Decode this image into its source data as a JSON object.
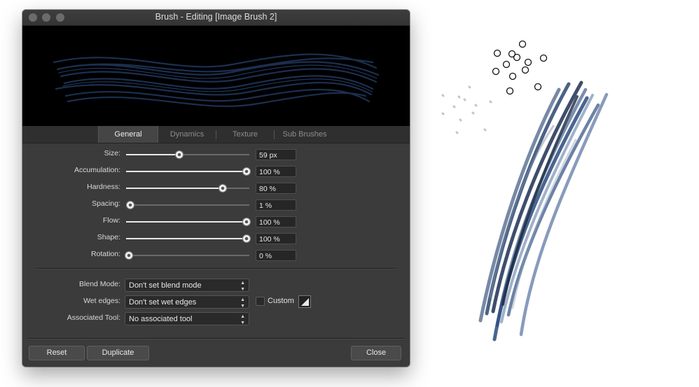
{
  "window": {
    "title": "Brush - Editing [Image Brush 2]"
  },
  "tabs": [
    {
      "label": "General",
      "active": true
    },
    {
      "label": "Dynamics",
      "active": false
    },
    {
      "label": "Texture",
      "active": false
    },
    {
      "label": "Sub Brushes",
      "active": false
    }
  ],
  "sliders": [
    {
      "label": "Size:",
      "fraction": 0.43,
      "value": "59 px"
    },
    {
      "label": "Accumulation:",
      "fraction": 1.0,
      "value": "100 %"
    },
    {
      "label": "Hardness:",
      "fraction": 0.8,
      "value": "80 %"
    },
    {
      "label": "Spacing:",
      "fraction": 0.01,
      "value": "1 %"
    },
    {
      "label": "Flow:",
      "fraction": 1.0,
      "value": "100 %"
    },
    {
      "label": "Shape:",
      "fraction": 1.0,
      "value": "100 %"
    },
    {
      "label": "Rotation:",
      "fraction": 0.0,
      "value": "0 %"
    }
  ],
  "blend_mode": {
    "label": "Blend Mode:",
    "value": "Don't set blend mode"
  },
  "wet_edges": {
    "label": "Wet edges:",
    "value": "Don't set wet edges",
    "custom_label": "Custom",
    "custom_checked": false
  },
  "associated_tool": {
    "label": "Associated Tool:",
    "value": "No associated tool"
  },
  "buttons": {
    "reset": "Reset",
    "duplicate": "Duplicate",
    "close": "Close"
  },
  "colors": {
    "stroke": "#2b4a78",
    "dialog_bg": "#3b3b3b"
  }
}
